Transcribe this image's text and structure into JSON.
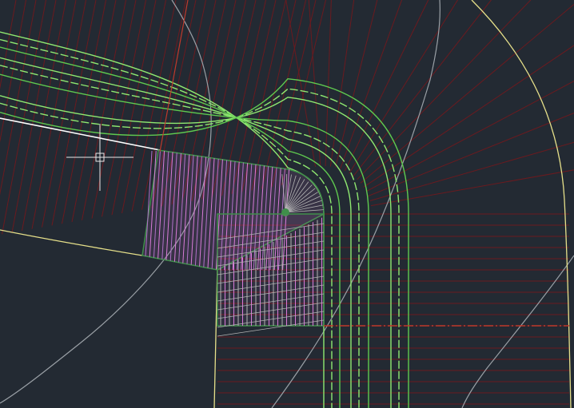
{
  "canvas": {
    "background": "#232a33",
    "line_colors": {
      "station_lines": "#6b1a1f",
      "curb_lines": "#8fe870",
      "curb_dash": "#5fc94f",
      "edge_white": "#ffffff",
      "edge_yellow": "#e6e08a",
      "contour_gray": "#9aa0a6",
      "hatch_magenta": "#d97bd9",
      "hatch_gray": "#b3b3b3",
      "region_green": "#3f8f4a",
      "centerline_red": "#c0392b"
    }
  },
  "cursor": {
    "type": "crosshair-pickbox"
  },
  "drawing_objects": [
    "station-lines",
    "curb-return-lines",
    "edge-of-pavement",
    "existing-contours",
    "sidewalk-corner-hatch",
    "ramp-hatch",
    "alignment-centerline"
  ]
}
